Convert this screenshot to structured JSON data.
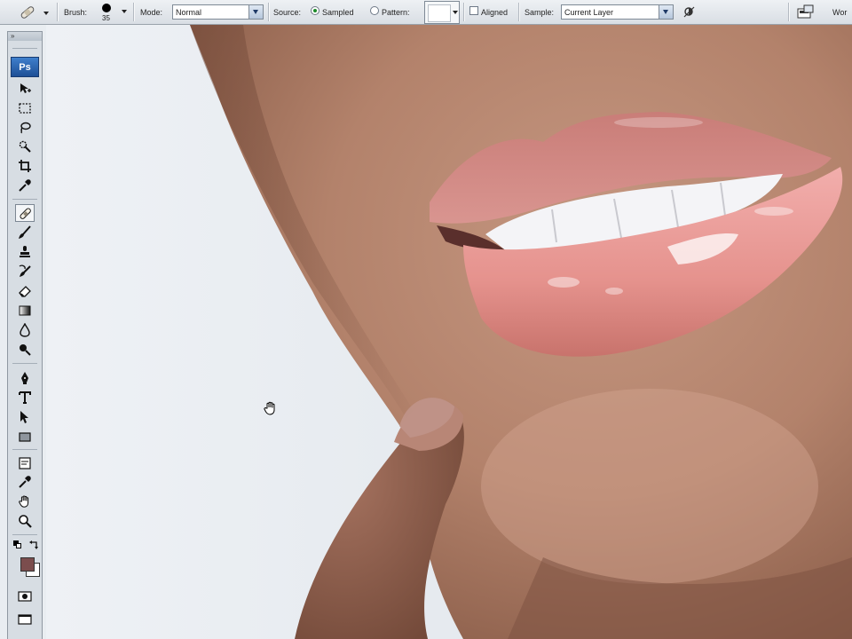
{
  "options_bar": {
    "brush_label": "Brush:",
    "brush_size": "35",
    "mode_label": "Mode:",
    "mode_value": "Normal",
    "source_label": "Source:",
    "source_sampled": "Sampled",
    "source_pattern": "Pattern:",
    "source_selected": "Sampled",
    "aligned_label": "Aligned",
    "aligned_checked": false,
    "sample_label": "Sample:",
    "sample_value": "Current Layer",
    "workspace_label": "Wor"
  },
  "tools_panel": {
    "logo": "Ps",
    "grip": "»",
    "active_tool": "healing-brush",
    "foreground_color": "#7b4d4d",
    "background_color": "#ffffff"
  },
  "canvas": {
    "subject": "close-up photo of lips and chin with a hand",
    "cursor": "hand-cursor"
  }
}
